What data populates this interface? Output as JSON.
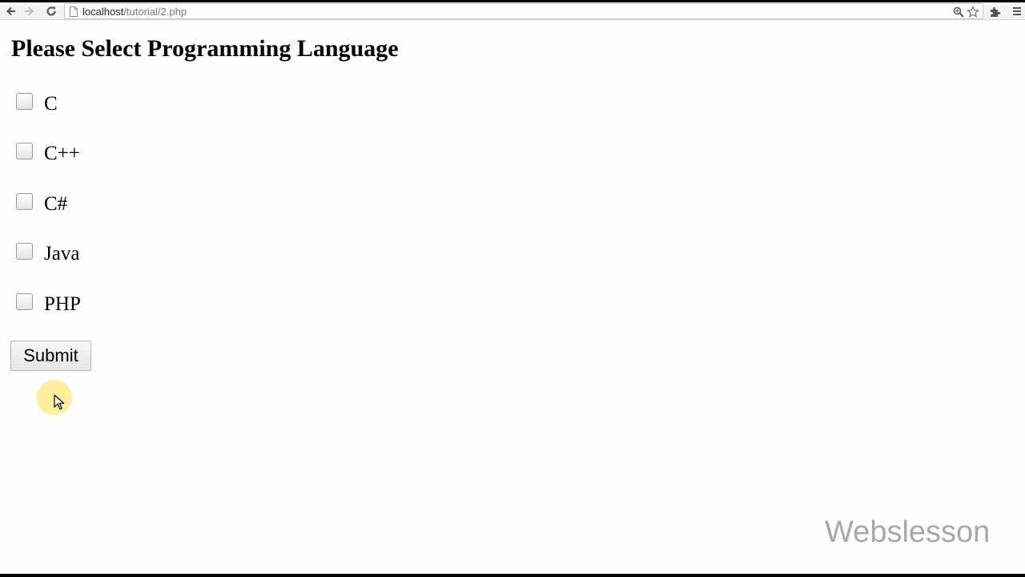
{
  "browser": {
    "url_host": "localhost",
    "url_path": "/tutorial/2.php"
  },
  "page": {
    "title": "Please Select Programming Language",
    "options": [
      {
        "label": "C",
        "checked": false
      },
      {
        "label": "C++",
        "checked": false
      },
      {
        "label": "C#",
        "checked": false
      },
      {
        "label": "Java",
        "checked": false
      },
      {
        "label": "PHP",
        "checked": false
      }
    ],
    "submit_label": "Submit"
  },
  "watermark": "Webslesson",
  "icons": {
    "back": "back-arrow-icon",
    "forward": "forward-arrow-icon",
    "reload": "reload-icon",
    "page": "page-icon",
    "zoom": "zoom-icon",
    "bookmark": "star-icon",
    "extensions": "puzzle-piece-icon",
    "menu": "hamburger-menu-icon",
    "cursor": "mouse-pointer-icon"
  },
  "colors": {
    "cursor_highlight": "#ffe878",
    "watermark": "#a8a8a8"
  }
}
